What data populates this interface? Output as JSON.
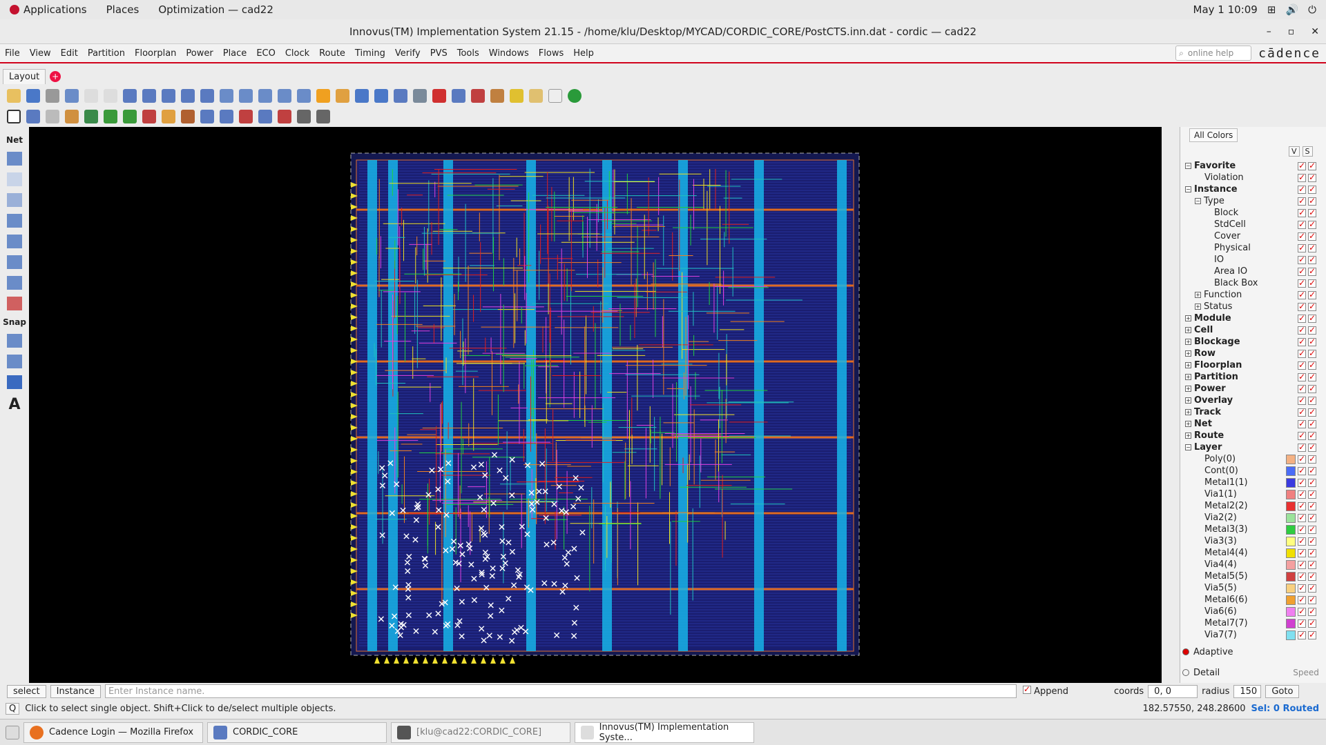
{
  "topbar": {
    "applications": "Applications",
    "places": "Places",
    "active_app": "Optimization — cad22",
    "datetime": "May 1  10:09"
  },
  "window": {
    "title": "Innovus(TM) Implementation System 21.15 - /home/klu/Desktop/MYCAD/CORDIC_CORE/PostCTS.inn.dat - cordic — cad22"
  },
  "menu": [
    "File",
    "View",
    "Edit",
    "Partition",
    "Floorplan",
    "Power",
    "Place",
    "ECO",
    "Clock",
    "Route",
    "Timing",
    "Verify",
    "PVS",
    "Tools",
    "Windows",
    "Flows",
    "Help"
  ],
  "help_search": {
    "placeholder": "online help"
  },
  "brand": "cādence",
  "tabs": {
    "layout": "Layout"
  },
  "left_tools": {
    "net": "Net",
    "snap": "Snap",
    "text": "A"
  },
  "right_panel": {
    "all_colors": "All Colors",
    "vs": [
      "V",
      "S"
    ],
    "tree": [
      {
        "label": "Favorite",
        "bold": true,
        "level": 0
      },
      {
        "label": "Violation",
        "bold": false,
        "level": 2
      },
      {
        "label": "Instance",
        "bold": true,
        "level": 0
      },
      {
        "label": "Type",
        "bold": false,
        "level": 1
      },
      {
        "label": "Block",
        "bold": false,
        "level": 3
      },
      {
        "label": "StdCell",
        "bold": false,
        "level": 3
      },
      {
        "label": "Cover",
        "bold": false,
        "level": 3
      },
      {
        "label": "Physical",
        "bold": false,
        "level": 3
      },
      {
        "label": "IO",
        "bold": false,
        "level": 3
      },
      {
        "label": "Area IO",
        "bold": false,
        "level": 3
      },
      {
        "label": "Black Box",
        "bold": false,
        "level": 3
      },
      {
        "label": "Function",
        "bold": false,
        "level": 1
      },
      {
        "label": "Status",
        "bold": false,
        "level": 1
      },
      {
        "label": "Module",
        "bold": true,
        "level": 0
      },
      {
        "label": "Cell",
        "bold": true,
        "level": 0
      },
      {
        "label": "Blockage",
        "bold": true,
        "level": 0
      },
      {
        "label": "Row",
        "bold": true,
        "level": 0
      },
      {
        "label": "Floorplan",
        "bold": true,
        "level": 0
      },
      {
        "label": "Partition",
        "bold": true,
        "level": 0
      },
      {
        "label": "Power",
        "bold": true,
        "level": 0
      },
      {
        "label": "Overlay",
        "bold": true,
        "level": 0
      },
      {
        "label": "Track",
        "bold": true,
        "level": 0
      },
      {
        "label": "Net",
        "bold": true,
        "level": 0
      },
      {
        "label": "Route",
        "bold": true,
        "level": 0
      },
      {
        "label": "Layer",
        "bold": true,
        "level": 0
      },
      {
        "label": "Poly(0)",
        "bold": false,
        "level": 2,
        "color": "#f4b183"
      },
      {
        "label": "Cont(0)",
        "bold": false,
        "level": 2,
        "color": "#4a6cf7"
      },
      {
        "label": "Metal1(1)",
        "bold": false,
        "level": 2,
        "color": "#3a3ae0"
      },
      {
        "label": "Via1(1)",
        "bold": false,
        "level": 2,
        "color": "#f08080"
      },
      {
        "label": "Metal2(2)",
        "bold": false,
        "level": 2,
        "color": "#e83030"
      },
      {
        "label": "Via2(2)",
        "bold": false,
        "level": 2,
        "color": "#9be39b"
      },
      {
        "label": "Metal3(3)",
        "bold": false,
        "level": 2,
        "color": "#2ecc40"
      },
      {
        "label": "Via3(3)",
        "bold": false,
        "level": 2,
        "color": "#ffff80"
      },
      {
        "label": "Metal4(4)",
        "bold": false,
        "level": 2,
        "color": "#f0e000"
      },
      {
        "label": "Via4(4)",
        "bold": false,
        "level": 2,
        "color": "#f4a0a0"
      },
      {
        "label": "Metal5(5)",
        "bold": false,
        "level": 2,
        "color": "#d04040"
      },
      {
        "label": "Via5(5)",
        "bold": false,
        "level": 2,
        "color": "#f8d080"
      },
      {
        "label": "Metal6(6)",
        "bold": false,
        "level": 2,
        "color": "#f0a030"
      },
      {
        "label": "Via6(6)",
        "bold": false,
        "level": 2,
        "color": "#f080f0"
      },
      {
        "label": "Metal7(7)",
        "bold": false,
        "level": 2,
        "color": "#d040d0"
      },
      {
        "label": "Via7(7)",
        "bold": false,
        "level": 2,
        "color": "#80e0f0"
      }
    ],
    "adaptive": "Adaptive",
    "detail": "Detail",
    "speed": "Speed"
  },
  "cmd": {
    "select": "select",
    "instance": "Instance",
    "placeholder": "Enter Instance name.",
    "append": "Append",
    "coords_label": "coords",
    "coords_value": "0, 0",
    "radius_label": "radius",
    "radius_value": "150",
    "goto": "Goto"
  },
  "status": {
    "hint": "Click to select single object. Shift+Click to de/select multiple objects.",
    "cursor": "182.57550, 248.28600",
    "sel": "Sel: 0 Routed"
  },
  "taskbar": [
    "Cadence Login — Mozilla Firefox",
    "CORDIC_CORE",
    "[klu@cad22:CORDIC_CORE]",
    "Innovus(TM) Implementation Syste..."
  ]
}
